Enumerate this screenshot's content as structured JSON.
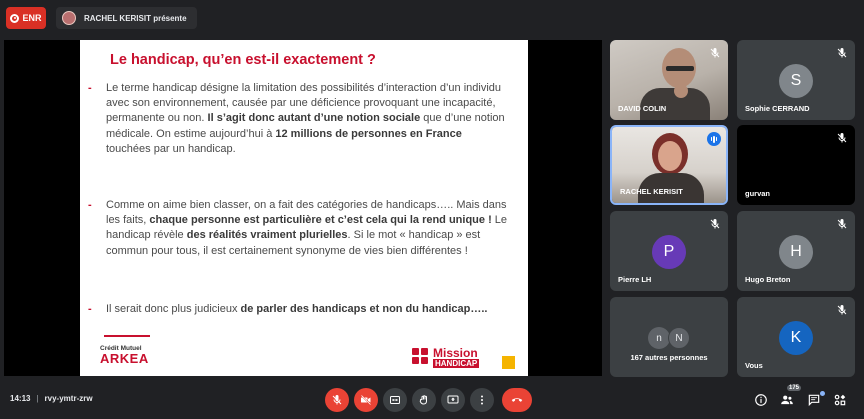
{
  "topbar": {
    "rec_label": "ENR",
    "presenter_text": "RACHEL KERISIT présente"
  },
  "slide": {
    "title": "Le handicap, qu’en est-il exactement ?",
    "bullet1_a": "Le terme handicap désigne la limitation des possibilités d’interaction d’un individu avec son environnement, causée par une déficience provoquant une incapacité, permanente ou non. ",
    "bullet1_b": "Il s’agit donc autant d’une notion sociale",
    "bullet1_c": " que d’une notion médicale. On estime aujourd’hui à ",
    "bullet1_d": "12 millions de personnes en France",
    "bullet1_e": " touchées par un handicap.",
    "bullet2_a": "Comme on aime bien classer, on a fait des catégories de handicaps….. Mais dans les faits, ",
    "bullet2_b": "chaque personne est particulière et c’est cela qui la rend unique !",
    "bullet2_c": " Le handicap révèle ",
    "bullet2_d": "des réalités vraiment plurielles",
    "bullet2_e": ". Si le mot « handicap » est commun pour tous, il est certainement synonyme de vies bien différentes !",
    "bullet3_a": "Il serait donc plus judicieux ",
    "bullet3_b": "de parler des handicaps et non du handicap…..",
    "dash": "-",
    "logo_left_top": "Crédit Mutuel",
    "logo_left_main": "ARKEA",
    "logo_mission_top": "Mission",
    "logo_mission_bottom": "HANDICAP"
  },
  "participants": {
    "david": "DAVID COLIN",
    "sophie": "Sophie CERRAND",
    "sophie_initial": "S",
    "rachel": "RACHEL KERISIT",
    "gurvan": "gurvan",
    "pierre": "Pierre LH",
    "pierre_initial": "P",
    "hugo": "Hugo Breton",
    "hugo_initial": "H",
    "others_label": "167 autres personnes",
    "others_initial_1": "n",
    "others_initial_2": "N",
    "vous": "Vous",
    "vous_initial": "K"
  },
  "bottombar": {
    "time": "14:13",
    "separator": "|",
    "meeting_code": "rvy-ymtr-zrw",
    "participant_count": "175"
  },
  "colors": {
    "accent_red": "#ea4335",
    "brand_red": "#c8102e",
    "pierre_avatar": "#673ab7",
    "hugo_avatar": "#80868b",
    "sophie_avatar": "#80868b",
    "vous_avatar": "#1565c0"
  }
}
